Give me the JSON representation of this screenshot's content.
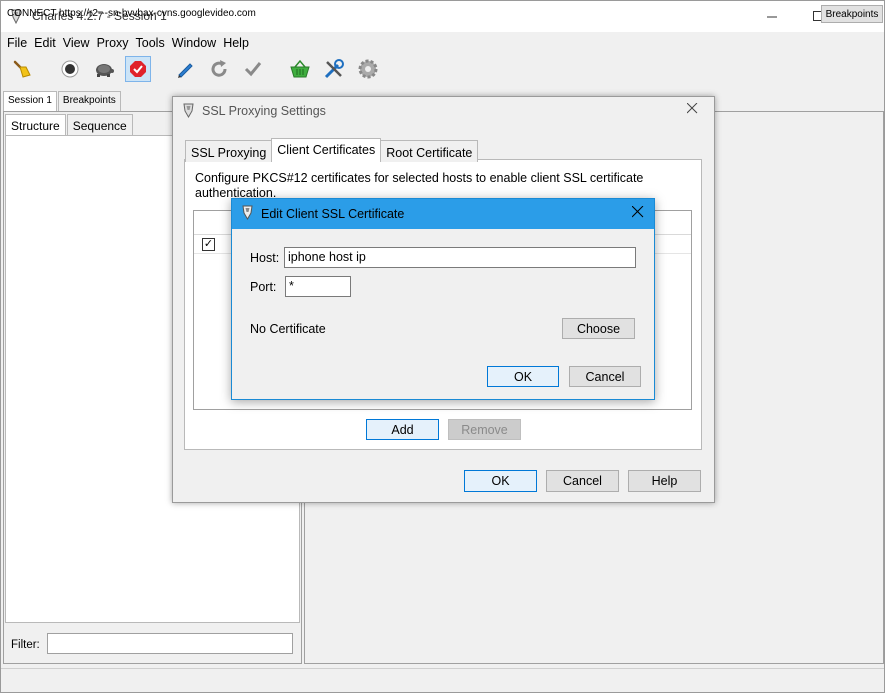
{
  "window": {
    "title": "Charles 4.2.7 - Session 1"
  },
  "menubar": [
    "File",
    "Edit",
    "View",
    "Proxy",
    "Tools",
    "Window",
    "Help"
  ],
  "toolbar": {
    "icons": [
      "broom-icon",
      "record-icon",
      "turtle-throttle-icon",
      "breakpoints-icon",
      "pen-compose-icon",
      "refresh-icon",
      "tick-validate-icon",
      "basket-icon",
      "tools-icon",
      "gear-settings-icon"
    ]
  },
  "session_tabs": [
    "Session 1",
    "Breakpoints"
  ],
  "view_tabs": [
    "Structure",
    "Sequence"
  ],
  "filter": {
    "label": "Filter:",
    "value": ""
  },
  "status": {
    "text": "CONNECT https://r2---sn-bvvbax-cvns.googlevideo.com",
    "button": "Breakpoints"
  },
  "ssl_dialog": {
    "title": "SSL Proxying Settings",
    "tabs": [
      "SSL Proxying",
      "Client Certificates",
      "Root Certificate"
    ],
    "selected_tab": "Client Certificates",
    "description": "Configure PKCS#12 certificates for selected hosts to enable client SSL certificate authentication.",
    "table": {
      "row_checked": true
    },
    "add_label": "Add",
    "remove_label": "Remove",
    "ok_label": "OK",
    "cancel_label": "Cancel",
    "help_label": "Help"
  },
  "edit_dialog": {
    "title": "Edit Client SSL Certificate",
    "host_label": "Host:",
    "host_value": "iphone host ip",
    "port_label": "Port:",
    "port_value": "*",
    "cert_status": "No Certificate",
    "choose_label": "Choose",
    "ok_label": "OK",
    "cancel_label": "Cancel"
  }
}
